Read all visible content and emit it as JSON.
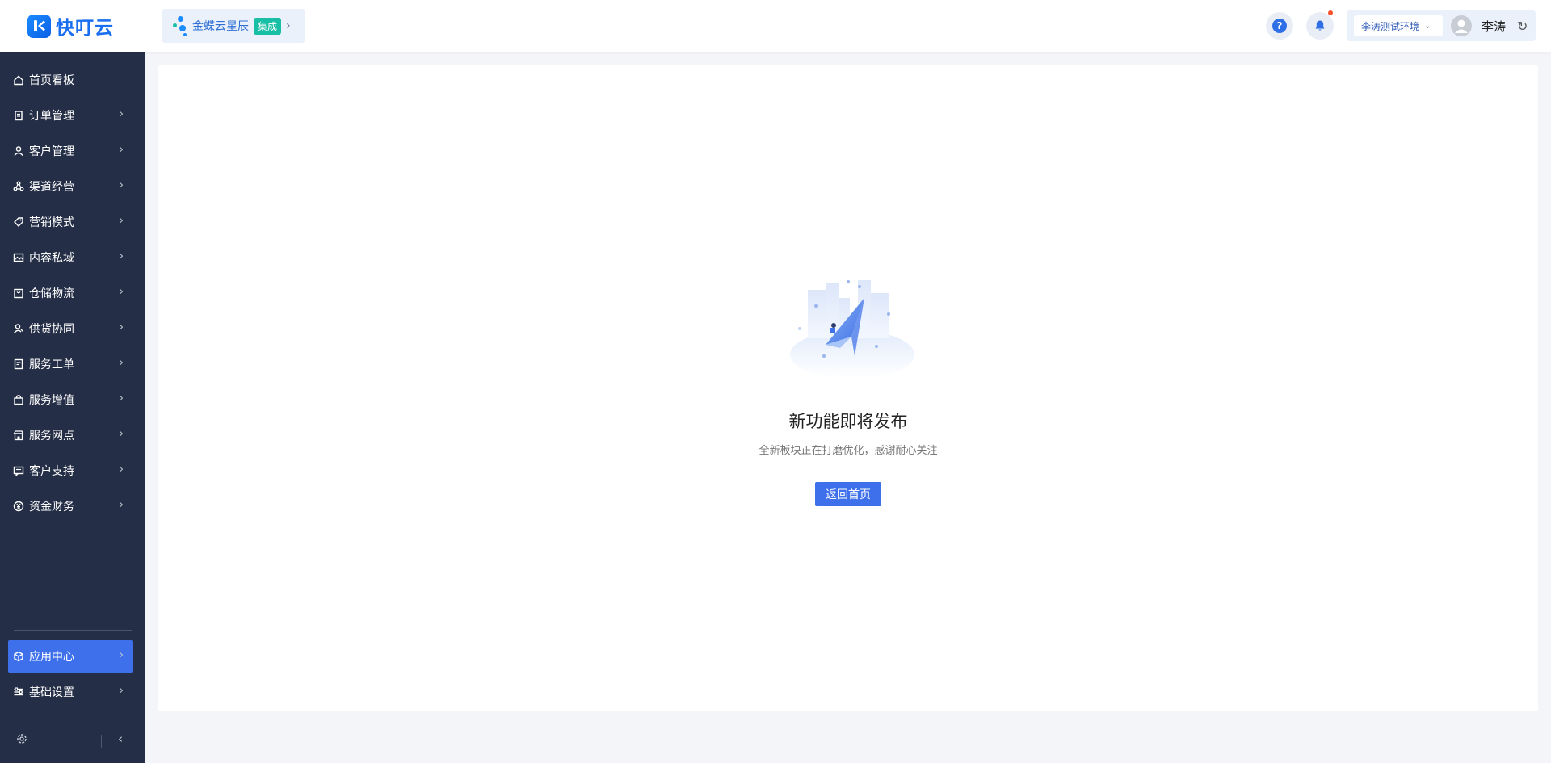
{
  "header": {
    "logo_text": "快叮云",
    "integration": {
      "label": "金蝶云星辰",
      "badge": "集成"
    },
    "env_select": "李涛测试环境",
    "user_name": "李涛"
  },
  "sidebar": {
    "items": [
      {
        "label": "首页看板",
        "icon": "home-icon",
        "has_chevron": false
      },
      {
        "label": "订单管理",
        "icon": "clipboard-icon",
        "has_chevron": true
      },
      {
        "label": "客户管理",
        "icon": "user-icon",
        "has_chevron": true
      },
      {
        "label": "渠道经营",
        "icon": "network-icon",
        "has_chevron": true
      },
      {
        "label": "营销模式",
        "icon": "tag-icon",
        "has_chevron": true
      },
      {
        "label": "内容私域",
        "icon": "image-icon",
        "has_chevron": true
      },
      {
        "label": "仓储物流",
        "icon": "box-icon",
        "has_chevron": true
      },
      {
        "label": "供货协同",
        "icon": "user-link-icon",
        "has_chevron": true
      },
      {
        "label": "服务工单",
        "icon": "document-icon",
        "has_chevron": true
      },
      {
        "label": "服务增值",
        "icon": "bag-icon",
        "has_chevron": true
      },
      {
        "label": "服务网点",
        "icon": "store-icon",
        "has_chevron": true
      },
      {
        "label": "客户支持",
        "icon": "chat-icon",
        "has_chevron": true
      },
      {
        "label": "资金财务",
        "icon": "yen-icon",
        "has_chevron": true
      }
    ],
    "bottom_items": [
      {
        "label": "应用中心",
        "icon": "cube-icon",
        "active": true
      },
      {
        "label": "基础设置",
        "icon": "sliders-icon",
        "active": false
      }
    ]
  },
  "main": {
    "title": "新功能即将发布",
    "description": "全新板块正在打磨优化，感谢耐心关注",
    "button_label": "返回首页"
  },
  "colors": {
    "sidebar_bg": "#242e46",
    "accent": "#3e70ec",
    "header_bg": "#ffffff",
    "page_bg": "#f4f5f8"
  }
}
